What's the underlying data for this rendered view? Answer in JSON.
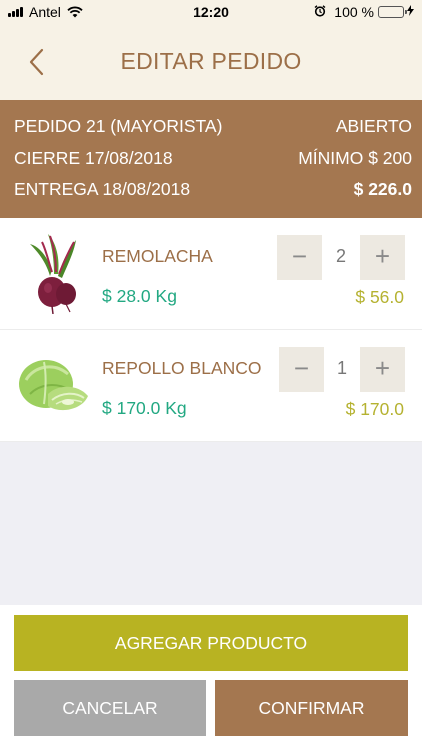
{
  "status_bar": {
    "carrier": "Antel",
    "time": "12:20",
    "battery": "100 %",
    "battery_level": 1.0,
    "icons": [
      "signal-icon",
      "wifi-icon",
      "alarm-icon",
      "battery-icon",
      "charging-bolt-icon"
    ]
  },
  "nav": {
    "title": "EDITAR PEDIDO",
    "back_icon": "chevron-left-icon"
  },
  "order": {
    "pedido": "PEDIDO 21 (MAYORISTA)",
    "estado": "ABIERTO",
    "cierre": "CIERRE  17/08/2018",
    "minimo": "MÍNIMO $ 200",
    "entrega": "ENTREGA  18/08/2018",
    "total": "$ 226.0"
  },
  "products": [
    {
      "name": "REMOLACHA",
      "price": "$ 28.0 Kg",
      "quantity": "2",
      "subtotal": "$ 56.0",
      "minus": "−",
      "plus": "+",
      "image_icon": "beet-image"
    },
    {
      "name": "REPOLLO BLANCO",
      "price": "$ 170.0 Kg",
      "quantity": "1",
      "subtotal": "$ 170.0",
      "minus": "−",
      "plus": "+",
      "image_icon": "cabbage-image"
    }
  ],
  "actions": {
    "add_product": "AGREGAR PRODUCTO",
    "cancel": "CANCELAR",
    "confirm": "CONFIRMAR"
  },
  "colors": {
    "nav_bg": "#f7f2e6",
    "brand_brown": "#a47750",
    "title_brown": "#9c6f48",
    "price_green": "#22a882",
    "subtotal_olive": "#b5b231",
    "add_button": "#b8b322",
    "cancel_button": "#a9a9a9"
  }
}
